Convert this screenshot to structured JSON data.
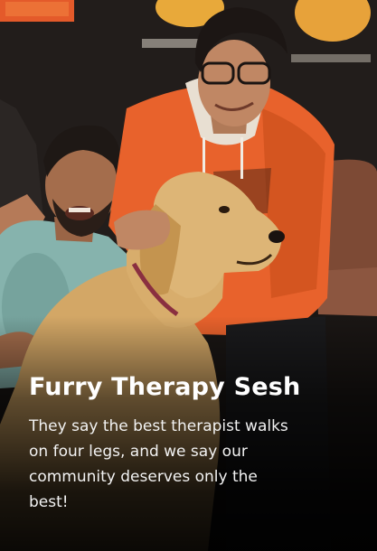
{
  "card": {
    "title": "Furry Therapy Sesh",
    "description": "They say the best therapist walks on four legs, and we say our community deserves only the best!"
  },
  "photo": {
    "subject": "dog-with-people"
  },
  "colors": {
    "wall": "#221d1b",
    "hoodie": "#e8622c",
    "dog": "#d3a766",
    "shirt": "#86b3ad",
    "title_text": "#ffffff"
  }
}
